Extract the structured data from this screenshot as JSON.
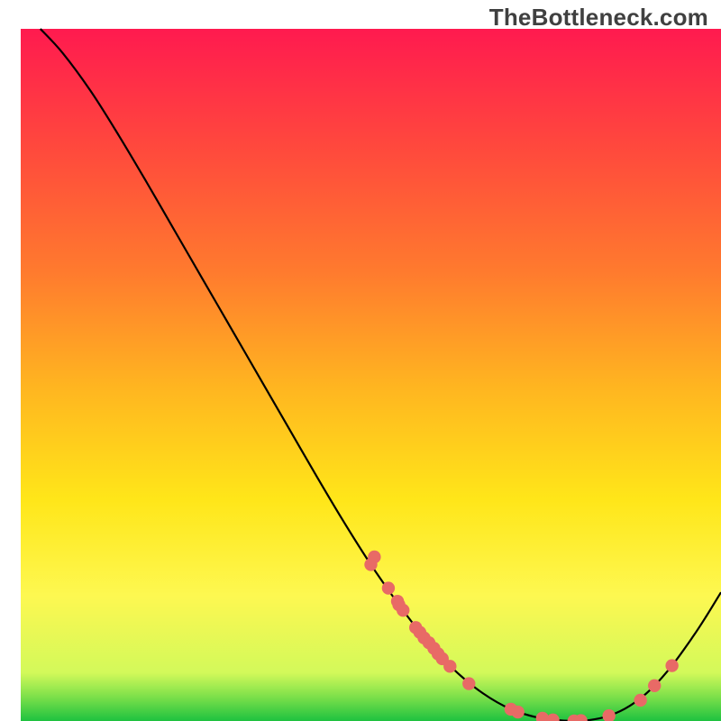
{
  "watermark": "TheBottleneck.com",
  "chart_data": {
    "type": "line",
    "title": "",
    "xlabel": "",
    "ylabel": "",
    "xlim": [
      0,
      100
    ],
    "ylim": [
      0,
      100
    ],
    "notes": "Gradient background from red (top, high bottleneck) through orange/yellow to green (bottom, low bottleneck). Black curve is a V-shaped bottleneck profile with minimum near x≈79. Salmon dots mark sampled positions along the curve, denser on the descending mid-section and around the minimum.",
    "gradient_stops": [
      {
        "offset": 0.0,
        "color": "#ff1a4f"
      },
      {
        "offset": 0.18,
        "color": "#ff4b3c"
      },
      {
        "offset": 0.35,
        "color": "#ff7a2e"
      },
      {
        "offset": 0.52,
        "color": "#ffb620"
      },
      {
        "offset": 0.68,
        "color": "#ffe619"
      },
      {
        "offset": 0.82,
        "color": "#fdf851"
      },
      {
        "offset": 0.93,
        "color": "#d3f95a"
      },
      {
        "offset": 0.965,
        "color": "#7de04a"
      },
      {
        "offset": 1.0,
        "color": "#1ec240"
      }
    ],
    "curve": [
      {
        "x": 2.8,
        "y": 100.0
      },
      {
        "x": 6.0,
        "y": 96.5
      },
      {
        "x": 10.0,
        "y": 91.0
      },
      {
        "x": 14.0,
        "y": 84.6
      },
      {
        "x": 18.0,
        "y": 77.8
      },
      {
        "x": 22.0,
        "y": 70.8
      },
      {
        "x": 26.0,
        "y": 63.8
      },
      {
        "x": 30.0,
        "y": 56.8
      },
      {
        "x": 34.0,
        "y": 49.8
      },
      {
        "x": 38.0,
        "y": 42.8
      },
      {
        "x": 42.0,
        "y": 35.8
      },
      {
        "x": 46.0,
        "y": 29.0
      },
      {
        "x": 50.0,
        "y": 22.6
      },
      {
        "x": 54.0,
        "y": 16.8
      },
      {
        "x": 58.0,
        "y": 11.6
      },
      {
        "x": 62.0,
        "y": 7.3
      },
      {
        "x": 66.0,
        "y": 4.0
      },
      {
        "x": 70.0,
        "y": 1.7
      },
      {
        "x": 74.0,
        "y": 0.45
      },
      {
        "x": 77.0,
        "y": 0.1
      },
      {
        "x": 79.0,
        "y": 0.0
      },
      {
        "x": 81.0,
        "y": 0.1
      },
      {
        "x": 84.0,
        "y": 0.75
      },
      {
        "x": 87.0,
        "y": 2.2
      },
      {
        "x": 90.0,
        "y": 4.6
      },
      {
        "x": 93.0,
        "y": 8.0
      },
      {
        "x": 96.0,
        "y": 12.2
      },
      {
        "x": 98.0,
        "y": 15.3
      },
      {
        "x": 100.0,
        "y": 18.6
      }
    ],
    "points": [
      {
        "x": 50.0,
        "y": 22.6
      },
      {
        "x": 50.5,
        "y": 23.7
      },
      {
        "x": 52.5,
        "y": 19.2
      },
      {
        "x": 53.8,
        "y": 17.3
      },
      {
        "x": 54.0,
        "y": 16.8
      },
      {
        "x": 54.6,
        "y": 16.0
      },
      {
        "x": 56.4,
        "y": 13.5
      },
      {
        "x": 57.0,
        "y": 12.8
      },
      {
        "x": 57.6,
        "y": 12.0
      },
      {
        "x": 58.3,
        "y": 11.3
      },
      {
        "x": 59.0,
        "y": 10.5
      },
      {
        "x": 59.6,
        "y": 9.7
      },
      {
        "x": 60.2,
        "y": 9.0
      },
      {
        "x": 61.3,
        "y": 7.9
      },
      {
        "x": 64.0,
        "y": 5.4
      },
      {
        "x": 70.0,
        "y": 1.7
      },
      {
        "x": 71.0,
        "y": 1.3
      },
      {
        "x": 74.5,
        "y": 0.4
      },
      {
        "x": 76.0,
        "y": 0.15
      },
      {
        "x": 79.0,
        "y": 0.0
      },
      {
        "x": 80.0,
        "y": 0.05
      },
      {
        "x": 84.0,
        "y": 0.75
      },
      {
        "x": 88.5,
        "y": 3.0
      },
      {
        "x": 90.5,
        "y": 5.1
      },
      {
        "x": 93.0,
        "y": 8.0
      }
    ],
    "point_color": "#e86a66",
    "curve_color": "#000000"
  }
}
